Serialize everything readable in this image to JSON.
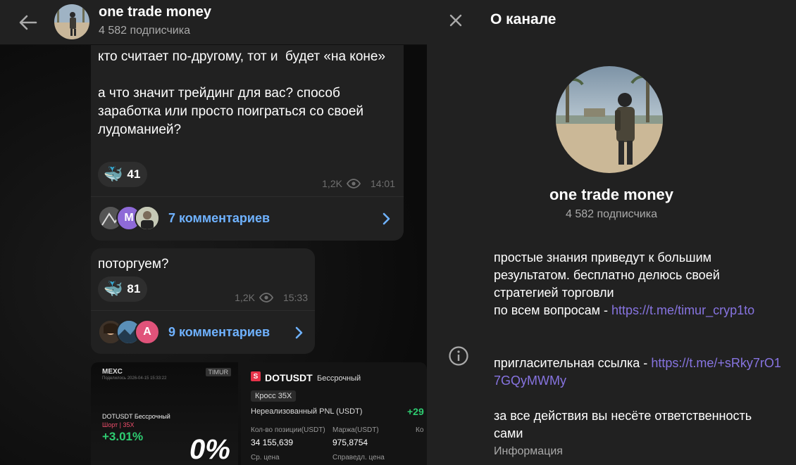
{
  "header": {
    "title": "one trade money",
    "subscribers": "4 582 подписчика"
  },
  "messages": [
    {
      "text": "кто считает по-другому, тот и  будет «на коне»\n\nа что значит трейдинг для вас? способ заработка или просто поиграться со своей лудоманией?",
      "reaction_count": "41",
      "views": "1,2K",
      "time": "14:01",
      "comments_label": "7 комментариев",
      "commenter_initial": "M"
    },
    {
      "text": "поторгуем?",
      "reaction_count": "81",
      "views": "1,2K",
      "time": "15:33",
      "comments_label": "9 комментариев",
      "commenter_initial": "A"
    }
  ],
  "media": {
    "card_a": {
      "logo": "MEXC",
      "tag": "TIMUR",
      "date": "Поделилось 2026-04-15 15:33:22",
      "pair": "DOTUSDT Бессрочный",
      "side": "Шорт | 35X",
      "pnl": "+3.01%",
      "big": "0%"
    },
    "card_b": {
      "badge": "S",
      "pair": "DOTUSDT",
      "perp": "Бессрочный",
      "cross": "Кросс 35X",
      "pnl_label": "Нереализованный PNL (USDT)",
      "pnl_value": "+29",
      "col1_label": "Кол-во позиции(USDT)",
      "col1_value": "34 155,639",
      "col2_label": "Маржа(USDT)",
      "col2_value": "975,8754",
      "col3_label": "Ко",
      "row2_col1_label": "Ср. цена",
      "row2_col2_label": "Справедл. цена"
    }
  },
  "panel": {
    "title": "О канале",
    "name": "one trade money",
    "subscribers": "4 582 подписчика",
    "desc1": "простые знания приведут к большим результатом. бесплатно делюсь своей стратегией торговли",
    "desc2_prefix": "по всем вопросам - ",
    "desc2_link": "https://t.me/timur_cryp1to",
    "desc3_prefix": "пригласительная ссылка - ",
    "desc3_link": "https://t.me/+sRky7rO17GQyMWMy",
    "desc4": "за все действия вы несёте ответственность сами",
    "caption": "Информация"
  },
  "colors": {
    "link": "#6fb2ff",
    "panel_link": "#8774e1",
    "panel_bg": "#212121"
  },
  "icons": [
    "back-arrow-icon",
    "close-icon",
    "info-icon",
    "eye-icon",
    "whale-icon",
    "chevron-right-icon"
  ]
}
